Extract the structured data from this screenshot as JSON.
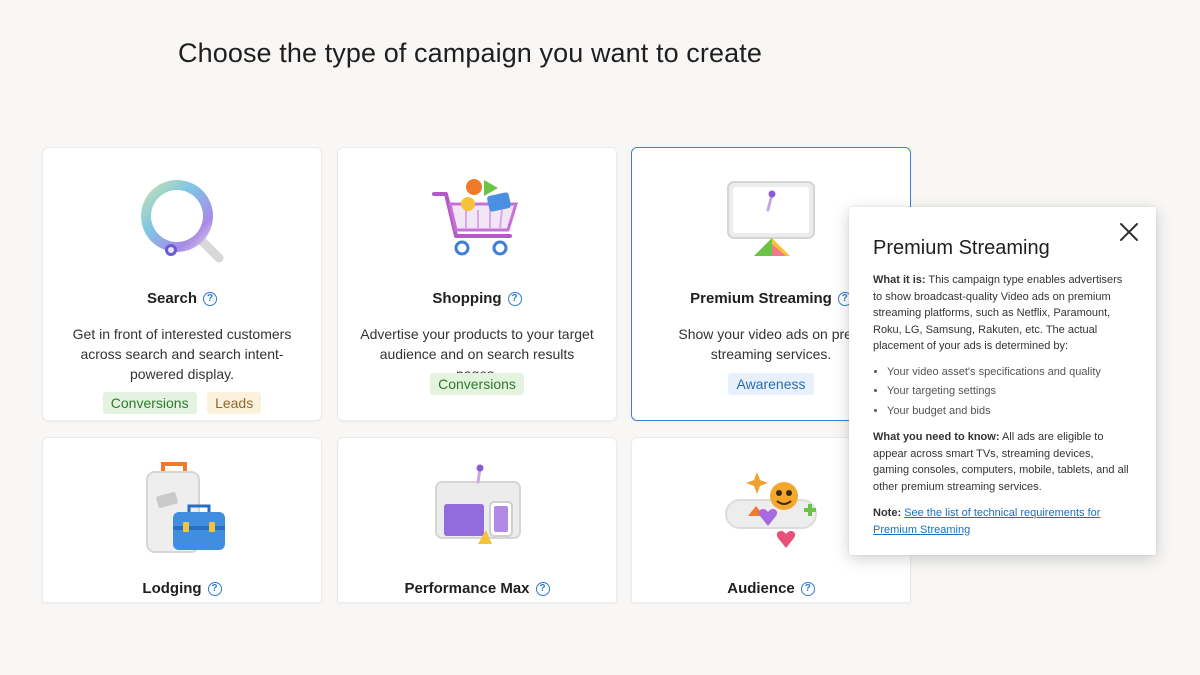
{
  "page": {
    "title": "Choose the type of campaign you want to create"
  },
  "cards": [
    {
      "title": "Search",
      "help": "?",
      "description": "Get in front of interested customers across search and search intent-powered display.",
      "tags": [
        "Conversions",
        "Leads"
      ]
    },
    {
      "title": "Shopping",
      "help": "?",
      "description": "Advertise your products to your target audience and on search results pages.",
      "tags": [
        "Conversions"
      ]
    },
    {
      "title": "Premium Streaming",
      "help": "?",
      "description": "Show your video ads on prem streaming services.",
      "tags": [
        "Awareness"
      ]
    },
    {
      "title": "Lodging",
      "help": "?"
    },
    {
      "title": "Performance Max",
      "help": "?"
    },
    {
      "title": "Audience",
      "help": "?"
    }
  ],
  "popover": {
    "title": "Premium Streaming",
    "what_label": "What it is:",
    "what_text": " This campaign type enables advertisers to show broadcast-quality Video ads on premium streaming platforms, such as Netflix, Paramount, Roku, LG, Samsung, Rakuten, etc. The actual placement of your ads is determined by:",
    "bullets": [
      "Your video asset's specifications and quality",
      "Your targeting settings",
      "Your budget and bids"
    ],
    "need_label": "What you need to know:",
    "need_text": " All ads are eligible to appear across smart TVs, streaming devices, gaming consoles, computers, mobile, tablets, and all other premium streaming services.",
    "note_label": "Note:",
    "note_link": "See the list of technical requirements for Premium Streaming"
  },
  "colors": {
    "accent": "#2b7bd1",
    "selected_border": "#3f7fd1",
    "tag_green_bg": "#e3f3df",
    "tag_orange_bg": "#fcf1dc",
    "tag_blue_bg": "#e8f1fb"
  },
  "icons": [
    "magnifier-icon",
    "shopping-cart-icon",
    "monitor-icon",
    "luggage-icon",
    "devices-icon",
    "emoji-icon",
    "close-icon",
    "help-icon"
  ]
}
